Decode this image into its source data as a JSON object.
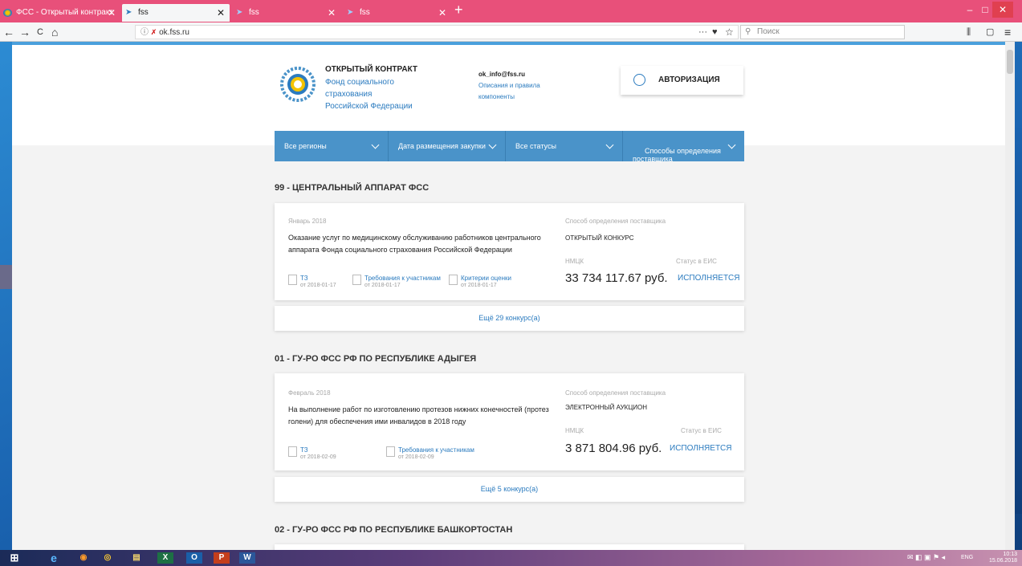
{
  "browser": {
    "tabs": [
      {
        "label": "ФСС - Открытый контракт",
        "active": false
      },
      {
        "label": "fss",
        "active": true
      },
      {
        "label": "fss",
        "active": false
      },
      {
        "label": "fss",
        "active": false
      }
    ],
    "new_tab": "+",
    "url": "ok.fss.ru",
    "search_placeholder": "Поиск",
    "win_min": "–",
    "win_max": "□",
    "win_close": "✕",
    "nav_back": "←",
    "nav_forward": "→",
    "nav_reload": "C",
    "nav_home": "⌂",
    "page_menu": "···",
    "pocket": "♥",
    "bookmark": "☆",
    "library": "⫼",
    "sidebar": "▢",
    "menu": "≡"
  },
  "site": {
    "title": "ОТКРЫТЫЙ КОНТРАКТ",
    "org_lines": [
      "Фонд социального",
      "страхования",
      "Российской Федерации"
    ],
    "email": "ok_info@fss.ru",
    "help_link_1": "Описания и правила",
    "help_link_2": "компоненты",
    "auth_button": "АВТОРИЗАЦИЯ"
  },
  "filters": [
    {
      "label": "Все регионы"
    },
    {
      "label": "Дата размещения закупки"
    },
    {
      "label": "Все статусы"
    },
    {
      "label": "Способы определения\nпоставщика"
    }
  ],
  "sections": [
    {
      "title": "99 - ЦЕНТРАЛЬНЫЙ АППАРАТ ФСС",
      "card": {
        "date": "Январь 2018",
        "description": "Оказание услуг по медицинскому обслуживанию работников центрального аппарата Фонда социального страхования Российской Федерации",
        "method_label": "Способ определения поставщика",
        "method": "ОТКРЫТЫЙ КОНКУРС",
        "price_label": "НМЦК",
        "price": "33 734 117.67 руб.",
        "status_label": "Статус в ЕИС",
        "status": "ИСПОЛНЯЕТСЯ",
        "docs": [
          {
            "title": "ТЗ",
            "date": "от 2018-01-17"
          },
          {
            "title": "Требования к участникам",
            "date": "от 2018-01-17"
          },
          {
            "title": "Критерии оценки",
            "date": "от 2018-01-17"
          }
        ]
      },
      "more": "Ещё 29 конкурс(а)"
    },
    {
      "title": "01 - ГУ-РО ФСС РФ ПО РЕСПУБЛИКЕ АДЫГЕЯ",
      "card": {
        "date": "Февраль 2018",
        "description": "На выполнение работ по изготовлению протезов нижних конечностей (протез голени) для обеспечения ими инвалидов в 2018 году",
        "method_label": "Способ определения поставщика",
        "method": "ЭЛЕКТРОННЫЙ АУКЦИОН",
        "price_label": "НМЦК",
        "price": "3 871 804.96 руб.",
        "status_label": "Статус в ЕИС",
        "status": "ИСПОЛНЯЕТСЯ",
        "docs": [
          {
            "title": "ТЗ",
            "date": "от 2018-02-09"
          },
          {
            "title": "Требования к участникам",
            "date": "от 2018-02-09"
          }
        ]
      },
      "more": "Ещё 5 конкурс(а)"
    },
    {
      "title": "02 - ГУ-РО ФСС РФ ПО РЕСПУБЛИКЕ БАШКОРТОСТАН"
    }
  ],
  "taskbar": {
    "start": "⊞",
    "items": [
      "e",
      "◉",
      "◎",
      "▤",
      "X",
      "O",
      "P",
      "W"
    ],
    "lang": "ENG",
    "time": "10:13",
    "date": "15.06.2018"
  },
  "colors": {
    "accent": "#2b7bbf",
    "filter_bar": "#4a93c9",
    "tab_bar": "#e8507a"
  }
}
